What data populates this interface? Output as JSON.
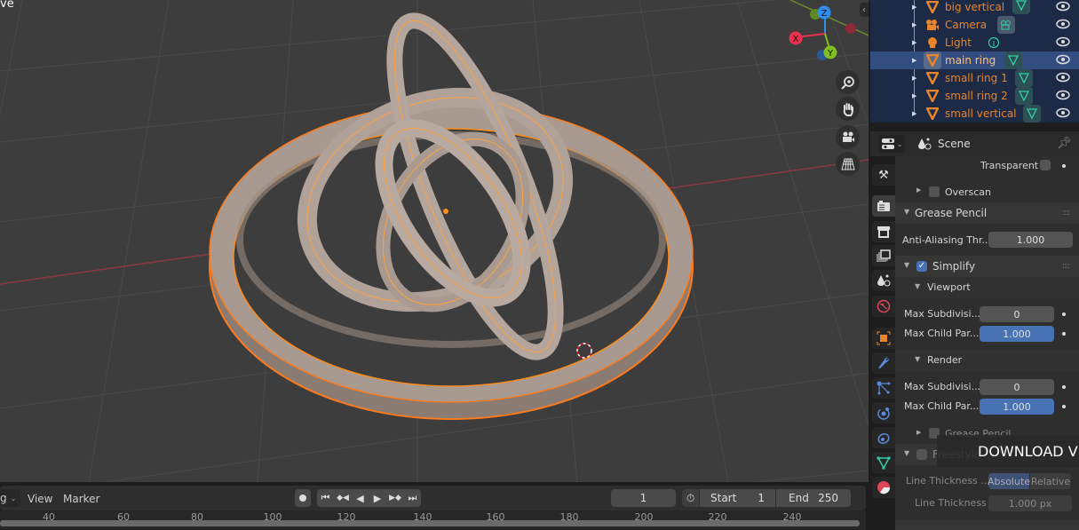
{
  "viewport": {
    "mode_label": "ve",
    "gizmo": {
      "x": "X",
      "y": "Y",
      "z": "Z"
    },
    "nav_buttons": [
      "zoom-icon",
      "hand-pan-icon",
      "camera-view-icon",
      "grid-ortho-icon"
    ],
    "colors": {
      "background": "#3d3d3d",
      "selection": "#ff8c1a",
      "object": "#a89a90",
      "x_axis": "#c33e4f",
      "y_axis": "#7fb22f"
    }
  },
  "timeline": {
    "mode_select": "g",
    "menus": [
      "View",
      "Marker"
    ],
    "playback_buttons": [
      "record-icon",
      "jump-start-icon",
      "prev-keyframe-icon",
      "play-reverse-icon",
      "play-icon",
      "next-keyframe-icon",
      "jump-end-icon"
    ],
    "current_frame": "1",
    "start_label": "Start",
    "start_value": "1",
    "end_label": "End",
    "end_value": "250",
    "ruler_ticks": [
      "40",
      "60",
      "80",
      "100",
      "120",
      "140",
      "160",
      "180",
      "200",
      "220",
      "240"
    ]
  },
  "outliner": {
    "items": [
      {
        "name": "big vertical",
        "type": "mesh",
        "selected": false
      },
      {
        "name": "Camera",
        "type": "camera",
        "selected": false
      },
      {
        "name": "Light",
        "type": "light",
        "selected": false
      },
      {
        "name": "main ring",
        "type": "mesh",
        "selected": true
      },
      {
        "name": "small ring 1",
        "type": "mesh",
        "selected": false
      },
      {
        "name": "small ring 2",
        "type": "mesh",
        "selected": false
      },
      {
        "name": "small vertical",
        "type": "mesh",
        "selected": false
      }
    ]
  },
  "properties": {
    "context": "Scene",
    "tabs": [
      "tool-icon",
      "render-icon",
      "output-icon",
      "view-layer-icon",
      "scene-icon",
      "world-icon",
      "object-icon",
      "modifier-icon",
      "particles-icon",
      "physics-icon",
      "constraints-icon",
      "object-data-icon",
      "material-icon"
    ],
    "transparent_label": "Transparent",
    "overscan_label": "Overscan",
    "grease_pencil_panel": "Grease Pencil",
    "anti_aliasing_label": "Anti-Aliasing Thr...",
    "anti_aliasing_value": "1.000",
    "simplify_panel": "Simplify",
    "simplify_enabled": true,
    "viewport_sub": "Viewport",
    "render_sub": "Render",
    "viewport_max_subdiv_label": "Max Subdivisi...",
    "viewport_max_subdiv_value": "0",
    "viewport_max_child_label": "Max Child Par...",
    "viewport_max_child_value": "1.000",
    "render_max_subdiv_label": "Max Subdivisi...",
    "render_max_subdiv_value": "0",
    "render_max_child_label": "Max Child Par...",
    "render_max_child_value": "1.000",
    "grease_pencil_sub": "Grease Pencil",
    "freestyle_panel": "Freestyle",
    "line_thickness_mode_label": "Line Thickness ...",
    "line_thickness_modes": [
      "Absolute",
      "Relative"
    ],
    "line_thickness_mode_selected": "Absolute",
    "line_thickness_label": "Line Thickness",
    "line_thickness_value": "1.000 px"
  },
  "overlay": {
    "download_text": "DOWNLOAD VI"
  }
}
